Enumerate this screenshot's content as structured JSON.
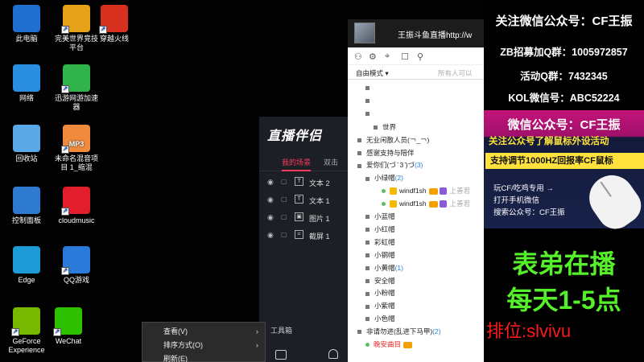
{
  "desktop": {
    "icons": [
      {
        "label": "此电脑",
        "icon": "computer-icon",
        "color": "#1f6fd1"
      },
      {
        "label": "完美世界竞技平台",
        "icon": "perfect-world-icon",
        "color": "#e7a21a"
      },
      {
        "label": "穿越火线",
        "icon": "crossfire-icon",
        "color": "#d8301e"
      },
      {
        "label": "网络",
        "icon": "network-icon",
        "color": "#2a8ee0"
      },
      {
        "label": "迅游网游加速器",
        "icon": "xunyou-icon",
        "color": "#2fb34a"
      },
      {
        "label": "回收站",
        "icon": "recycle-bin-icon",
        "color": "#5aa9e6"
      },
      {
        "label": "未命名混音项目 1_缩混",
        "icon": "mp3-file-icon",
        "color": "#f08a3c"
      },
      {
        "label": "控制面板",
        "icon": "control-panel-icon",
        "color": "#2f7ad1"
      },
      {
        "label": "cloudmusic",
        "icon": "netease-music-icon",
        "color": "#e21e2c"
      },
      {
        "label": "Edge",
        "icon": "edge-icon",
        "color": "#1d9bd6"
      },
      {
        "label": "QQ游戏",
        "icon": "qq-game-icon",
        "color": "#2a7bd9"
      },
      {
        "label": "GeForce Experience",
        "icon": "nvidia-icon",
        "color": "#76b900"
      },
      {
        "label": "WeChat",
        "icon": "wechat-icon",
        "color": "#2dc100"
      }
    ],
    "icon_badges": {
      "mp3": "MP3"
    }
  },
  "zbbl": {
    "logo": "直播伴侣",
    "tabs": [
      "我的场景",
      "双击"
    ],
    "layers": [
      {
        "name": "文本 2",
        "kind": "T"
      },
      {
        "name": "文本 1",
        "kind": "T"
      },
      {
        "name": "图片 1",
        "kind": "▣"
      },
      {
        "name": "截屏 1",
        "kind": "⌗"
      }
    ],
    "toolbox": "工具箱"
  },
  "context_menu": {
    "items": [
      {
        "label": "查看(V)",
        "arrow": "›"
      },
      {
        "label": "排序方式(O)",
        "arrow": "›"
      },
      {
        "label": "刷新(E)",
        "arrow": ""
      }
    ]
  },
  "douyu": {
    "title": "王振斗鱼直播http://w",
    "mode": "自由模式 ▾",
    "nobody": "所有人可以",
    "tree": [
      {
        "text": "",
        "indent": 1
      },
      {
        "text": "",
        "indent": 1
      },
      {
        "text": "",
        "indent": 1
      },
      {
        "text": "世界",
        "indent": 2
      },
      {
        "text": "无业闲散人员(￢_￢)",
        "indent": 0
      },
      {
        "text": "感谢支持与陪伴",
        "indent": 0
      },
      {
        "text": "爱你们(づ ̄ 3 ̄)づ",
        "indent": 0,
        "count": "(3)"
      },
      {
        "text": "小绿帽",
        "indent": 1,
        "count": "(2)"
      },
      {
        "text": "windf1sh",
        "indent": 3,
        "user": true,
        "trail": "上善若"
      },
      {
        "text": "windf1sh",
        "indent": 3,
        "user": true,
        "trail": "上善若"
      },
      {
        "text": "小蓝帽",
        "indent": 1
      },
      {
        "text": "小红帽",
        "indent": 1
      },
      {
        "text": "彩虹帽",
        "indent": 1
      },
      {
        "text": "小钢帽",
        "indent": 1
      },
      {
        "text": "小黄帽",
        "indent": 1,
        "count": "(1)"
      },
      {
        "text": "安全帽",
        "indent": 1
      },
      {
        "text": "小粉帽",
        "indent": 1
      },
      {
        "text": "小紫帽",
        "indent": 1
      },
      {
        "text": "小色帽",
        "indent": 1
      },
      {
        "text": "非请勿进(乱进下马甲)",
        "indent": 0,
        "count": "(2)"
      },
      {
        "text": "晚安曲目",
        "indent": 1,
        "red": true
      }
    ]
  },
  "promo": {
    "wechat_line": "关注微信公众号：CF王振",
    "qq_group": "ZB招募加Q群：1005972857",
    "event_group": "活动Q群：7432345",
    "kol_wechat": "KOL微信号：ABC52224",
    "banner": {
      "title": "微信公众号：CF王振",
      "subtitle": "关注公众号了解鼠标外设活动",
      "highlight": "支持调节1000HZ回报率CF鼠标",
      "steps": [
        "玩CF/吃鸡专用 →",
        "打开手机微信",
        "搜索公众号：CF王振"
      ]
    },
    "live_line1": "表弟在播",
    "live_line2": "每天1-5点",
    "rank": "排位:slvivu"
  }
}
